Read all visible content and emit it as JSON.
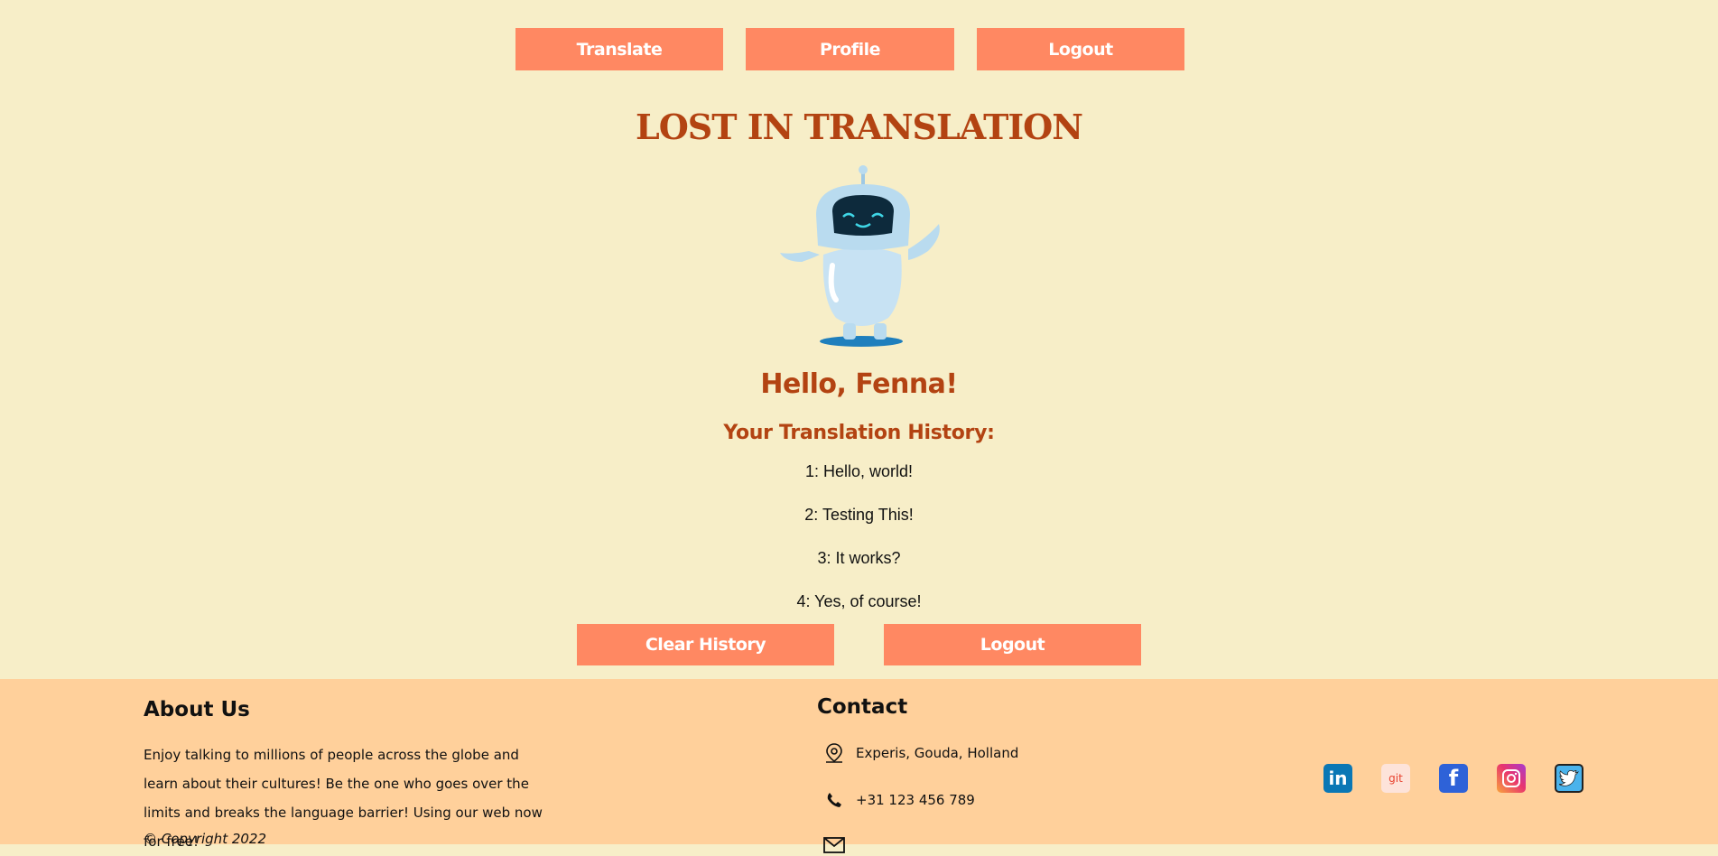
{
  "nav": {
    "translate": "Translate",
    "profile": "Profile",
    "logout": "Logout"
  },
  "page": {
    "title": "LOST IN TRANSLATION",
    "greeting": "Hello, Fenna!",
    "history_title": "Your Translation History:",
    "history": [
      "1: Hello, world!",
      "2: Testing This!",
      "3: It works?",
      "4: Yes, of course!"
    ],
    "clear_history": "Clear History",
    "logout": "Logout"
  },
  "footer": {
    "about_title": "About Us",
    "about_text": "Enjoy talking to millions of people across the globe and learn about their cultures! Be the one who goes over the limits and breaks the language barrier! Using our web now for free!",
    "copyright": "Copyright 2022",
    "contact_title": "Contact",
    "address": "Experis, Gouda, Holland",
    "phone": "+31 123 456 789",
    "email": "",
    "socials": [
      {
        "name": "linkedin-icon",
        "glyph": "in"
      },
      {
        "name": "git-icon",
        "glyph": "git"
      },
      {
        "name": "facebook-icon",
        "glyph": "f"
      },
      {
        "name": "instagram-icon",
        "glyph": ""
      },
      {
        "name": "twitter-icon",
        "glyph": ""
      }
    ]
  },
  "colors": {
    "background": "#f7eec8",
    "accent_button": "#ff8862",
    "heading": "#b34312",
    "footer": "#ffd09b"
  }
}
